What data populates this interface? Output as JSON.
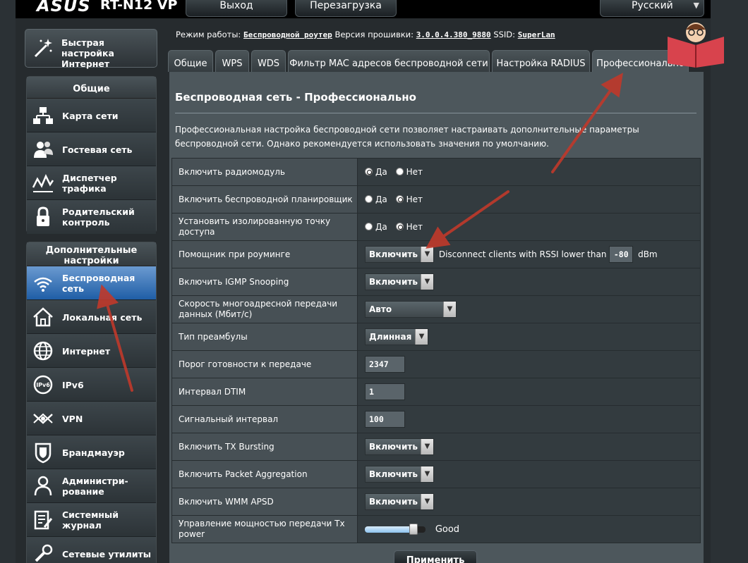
{
  "header": {
    "brand": "ASUS",
    "model": "RT-N12 VP",
    "logout_label": "Выход",
    "reboot_label": "Перезагрузка",
    "language": "Русский"
  },
  "sidebar": {
    "quick_setup": "Быстрая настройка Интернет",
    "general_title": "Общие",
    "general_items": [
      {
        "label": "Карта сети",
        "icon": "network-map-icon"
      },
      {
        "label": "Гостевая сеть",
        "icon": "guest-network-icon"
      },
      {
        "label": "Диспетчер трафика",
        "icon": "traffic-manager-icon"
      },
      {
        "label": "Родительский контроль",
        "icon": "parental-lock-icon"
      }
    ],
    "advanced_title": "Дополнительные настройки",
    "advanced_items": [
      {
        "label": "Беспроводная сеть",
        "icon": "wifi-icon",
        "active": true
      },
      {
        "label": "Локальная сеть",
        "icon": "home-icon"
      },
      {
        "label": "Интернет",
        "icon": "globe-icon"
      },
      {
        "label": "IPv6",
        "icon": "ipv6-icon"
      },
      {
        "label": "VPN",
        "icon": "vpn-icon"
      },
      {
        "label": "Брандмауэр",
        "icon": "firewall-icon"
      },
      {
        "label": "Администри-рование",
        "icon": "admin-icon"
      },
      {
        "label": "Системный журнал",
        "icon": "log-icon"
      },
      {
        "label": "Сетевые утилиты",
        "icon": "tools-icon"
      }
    ]
  },
  "status": {
    "mode_label": "Режим работы:",
    "mode_value": "Беспроводной роутер",
    "fw_label": "Версия прошивки:",
    "fw_value": "3.0.0.4.380_9880",
    "ssid_label": "SSID:",
    "ssid_value": "SuperLan"
  },
  "tabs": [
    {
      "label": "Общие"
    },
    {
      "label": "WPS"
    },
    {
      "label": "WDS"
    },
    {
      "label": "Фильтр MAC адресов беспроводной сети"
    },
    {
      "label": "Настройка RADIUS"
    },
    {
      "label": "Профессионально",
      "active": true
    }
  ],
  "main": {
    "title": "Беспроводная сеть - Профессионально",
    "description": "Профессиональная настройка беспроводной сети позволяет настраивать дополнительные параметры беспроводной сети. Однако рекомендуется использовать значения по умолчанию.",
    "yes": "Да",
    "no": "Нет",
    "rows": {
      "radio": {
        "label": "Включить радиомодуль",
        "value": "Да"
      },
      "scheduler": {
        "label": "Включить беспроводной планировщик",
        "value": "Нет"
      },
      "isolated_ap": {
        "label": "Установить изолированную точку доступа",
        "value": "Нет"
      },
      "roaming": {
        "label": "Помощник при роуминге",
        "value": "Включить",
        "extra": "Disconnect clients with RSSI lower than",
        "rssi": "-80",
        "unit": "dBm"
      },
      "igmp": {
        "label": "Включить IGMP Snooping",
        "value": "Включить"
      },
      "multicast": {
        "label": "Скорость многоадресной передачи данных (Мбит/с)",
        "value": "Авто"
      },
      "preamble": {
        "label": "Тип преамбулы",
        "value": "Длинная"
      },
      "rts": {
        "label": "Порог готовности к передаче",
        "value": "2347"
      },
      "dtim": {
        "label": "Интервал DTIM",
        "value": "1"
      },
      "beacon": {
        "label": "Сигнальный интервал",
        "value": "100"
      },
      "tx_bursting": {
        "label": "Включить TX Bursting",
        "value": "Включить"
      },
      "packet_agg": {
        "label": "Включить Packet Aggregation",
        "value": "Включить"
      },
      "wmm_apsd": {
        "label": "Включить WMM APSD",
        "value": "Включить"
      },
      "tx_power": {
        "label": "Управление мощностью передачи Tx power",
        "level": 0.8,
        "text": "Good"
      }
    },
    "apply_label": "Применить"
  },
  "colors": {
    "active_menu": "#3d7dc4",
    "arrow": "#c0392b",
    "panel": "#4d575c"
  }
}
